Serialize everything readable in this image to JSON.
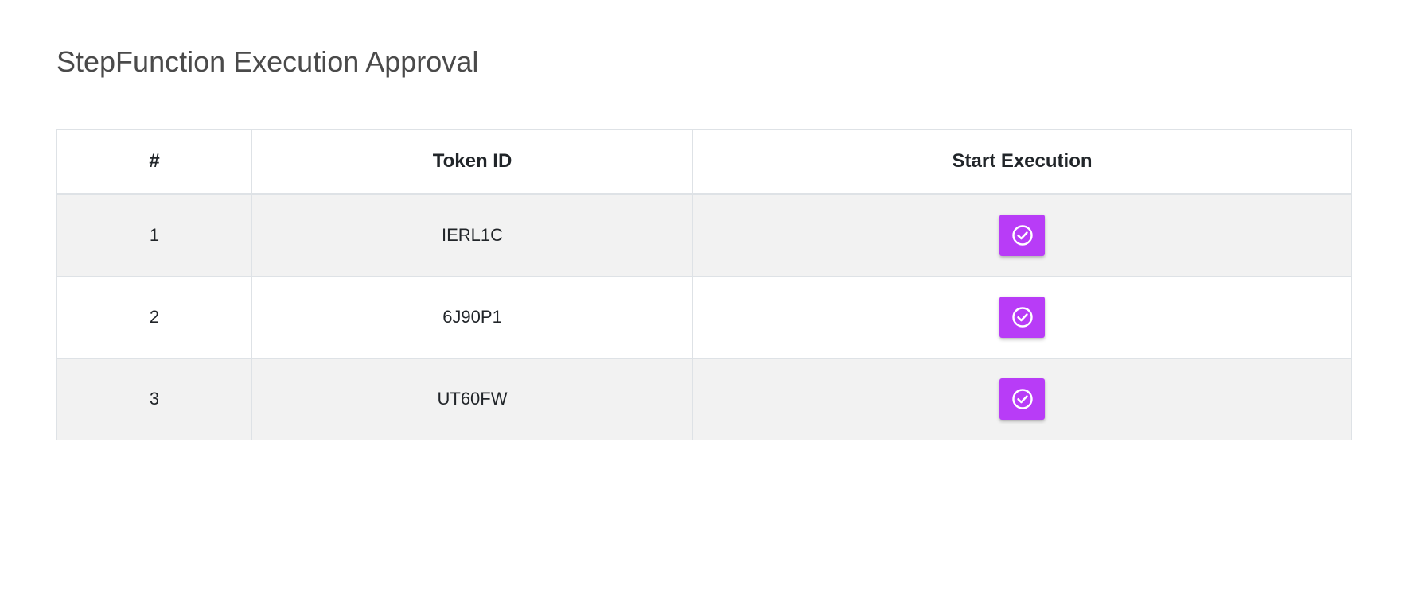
{
  "page": {
    "title": "StepFunction Execution Approval"
  },
  "table": {
    "columns": [
      "#",
      "Token ID",
      "Start Execution"
    ],
    "rows": [
      {
        "index": "1",
        "token_id": "IERL1C",
        "action_icon": "check-circle-icon"
      },
      {
        "index": "2",
        "token_id": "6J90P1",
        "action_icon": "check-circle-icon"
      },
      {
        "index": "3",
        "token_id": "UT60FW",
        "action_icon": "check-circle-icon"
      }
    ]
  },
  "colors": {
    "accent": "#b83cf7",
    "stripe": "#f2f2f2",
    "border": "#dee2e6",
    "title_text": "#4a4a4a"
  }
}
